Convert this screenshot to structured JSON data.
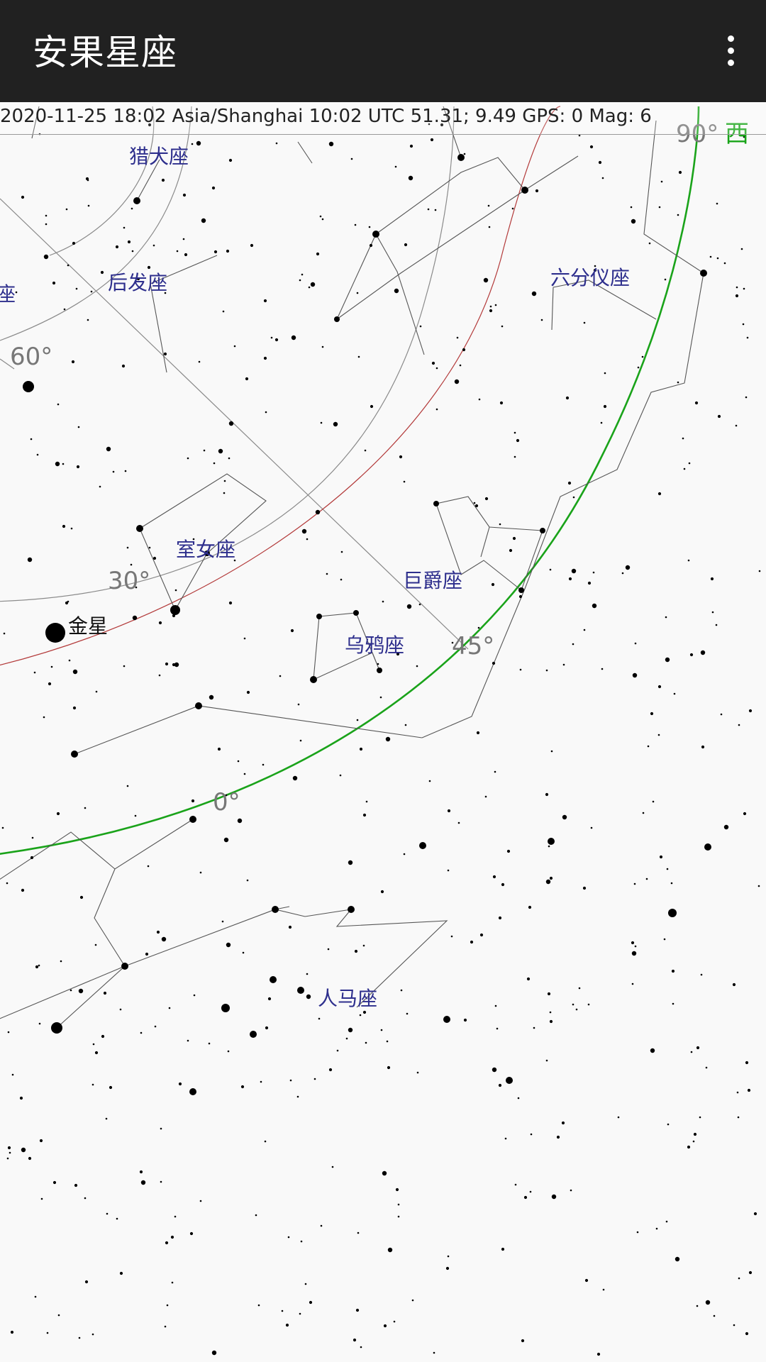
{
  "app": {
    "title": "安果星座"
  },
  "menu": {
    "overflow_icon": "more-vert-icon"
  },
  "status": {
    "text": "2020-11-25  18:02 Asia/Shanghai  10:02 UTC  51.31; 9.49 GPS: 0  Mag: 6"
  },
  "sky": {
    "constellations": {
      "canes_venatici": "猎犬座",
      "coma_berenices": "后发座",
      "sextans": "六分仪座",
      "virgo": "室女座",
      "crater": "巨爵座",
      "corvus": "乌鸦座",
      "sagittarius": "人马座",
      "partial_left": "座"
    },
    "planets": {
      "venus": "金星"
    },
    "degree_labels": {
      "deg60": "60°",
      "deg30": "30°",
      "deg45": "45°",
      "deg0": "0°",
      "deg90": "90°"
    },
    "directions": {
      "west": "西"
    },
    "colors": {
      "background": "#f9f9f9",
      "constellation_line": "#555555",
      "horizon": "#1aa31a",
      "ecliptic": "#b33a3a",
      "grid": "#8a8a8a",
      "constellation_label": "#2e2f8d",
      "star": "#000000"
    }
  }
}
